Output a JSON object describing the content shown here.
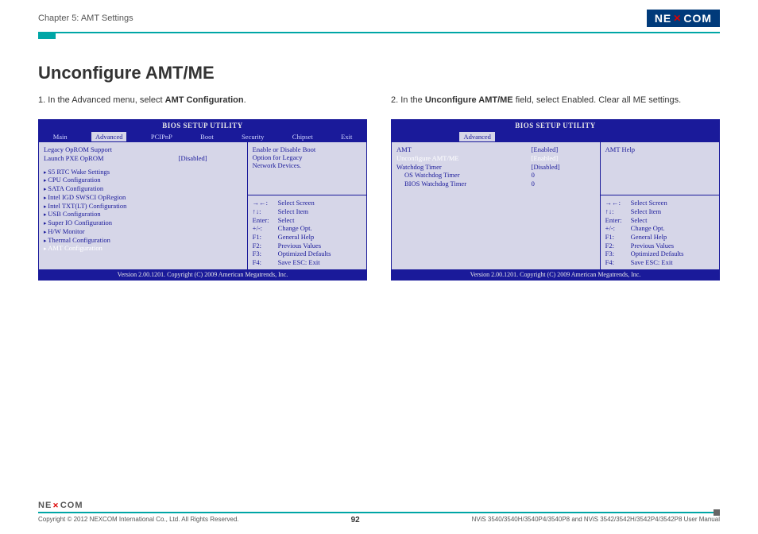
{
  "header": {
    "chapter": "Chapter 5: AMT Settings",
    "logo_left": "NE",
    "logo_x": "✕",
    "logo_right": "COM"
  },
  "title": "Unconfigure AMT/ME",
  "left": {
    "instruction_num": "1.",
    "instruction_pre": "In the Advanced menu, select ",
    "instruction_bold": "AMT Configuration",
    "instruction_post": ".",
    "bios_title": "BIOS SETUP UTILITY",
    "menu": [
      "Main",
      "Advanced",
      "PCIPnP",
      "Boot",
      "Security",
      "Chipset",
      "Exit"
    ],
    "menu_active": "Advanced",
    "rows": [
      {
        "label": "Legacy OpROM Support",
        "value": ""
      },
      {
        "label": "Launch PXE OpROM",
        "value": "[Disabled]"
      }
    ],
    "sub_items": [
      "S5 RTC Wake Settings",
      "CPU Configuration",
      "SATA Configuration",
      "Intel IGD SWSCI OpRegion",
      "Intel TXT(LT) Configuration",
      "USB Configuration",
      "Super IO Configuration",
      "H/W Monitor",
      "Thermal Configuration",
      "AMT Configuration"
    ],
    "highlight_item": "AMT Configuration",
    "help_top": [
      "Enable or Disable Boot",
      "Option for Legacy",
      "Network Devices."
    ],
    "help_keys": [
      {
        "k": "→←:",
        "t": "Select Screen"
      },
      {
        "k": "↑↓:",
        "t": "Select Item"
      },
      {
        "k": "Enter:",
        "t": "Select"
      },
      {
        "k": "+/-:",
        "t": "Change Opt."
      },
      {
        "k": "F1:",
        "t": "General Help"
      },
      {
        "k": "F2:",
        "t": "Previous Values"
      },
      {
        "k": "F3:",
        "t": "Optimized Defaults"
      },
      {
        "k": "F4:",
        "t": "Save   ESC:  Exit"
      }
    ],
    "footer": "Version 2.00.1201. Copyright (C) 2009 American Megatrends, Inc."
  },
  "right": {
    "instruction_num": "2.",
    "instruction_pre": "In the ",
    "instruction_bold": "Unconfigure AMT/ME",
    "instruction_post": " field, select Enabled. Clear all ME settings.",
    "bios_title": "BIOS SETUP UTILITY",
    "menu_item": "Advanced",
    "rows": [
      {
        "label": "AMT",
        "value": "[Enabled]",
        "hl": false
      },
      {
        "label": "Unconfigure AMT/ME",
        "value": "[Enabled]",
        "hl": true
      },
      {
        "label": "Watchdog Timer",
        "value": "[Disabled]",
        "hl": false
      },
      {
        "label": "OS Watchdog Timer",
        "value": "0",
        "hl": false,
        "indent": true
      },
      {
        "label": "BIOS Watchdog Timer",
        "value": "0",
        "hl": false,
        "indent": true
      }
    ],
    "help_top": [
      "AMT Help"
    ],
    "help_keys": [
      {
        "k": "→←:",
        "t": "Select Screen"
      },
      {
        "k": "↑↓:",
        "t": "Select Item"
      },
      {
        "k": "Enter:",
        "t": "Select"
      },
      {
        "k": "+/-:",
        "t": "Change Opt."
      },
      {
        "k": "F1:",
        "t": "General Help"
      },
      {
        "k": "F2:",
        "t": "Previous Values"
      },
      {
        "k": "F3:",
        "t": "Optimized Defaults"
      },
      {
        "k": "F4:",
        "t": "Save   ESC:  Exit"
      }
    ],
    "footer": "Version 2.00.1201. Copyright (C) 2009 American Megatrends, Inc."
  },
  "footer": {
    "logo_left": "NE",
    "logo_x": "✕",
    "logo_right": "COM",
    "copyright": "Copyright © 2012 NEXCOM International Co., Ltd. All Rights Reserved.",
    "page_num": "92",
    "right_text": "NViS 3540/3540H/3540P4/3540P8 and NViS 3542/3542H/3542P4/3542P8 User Manual"
  }
}
